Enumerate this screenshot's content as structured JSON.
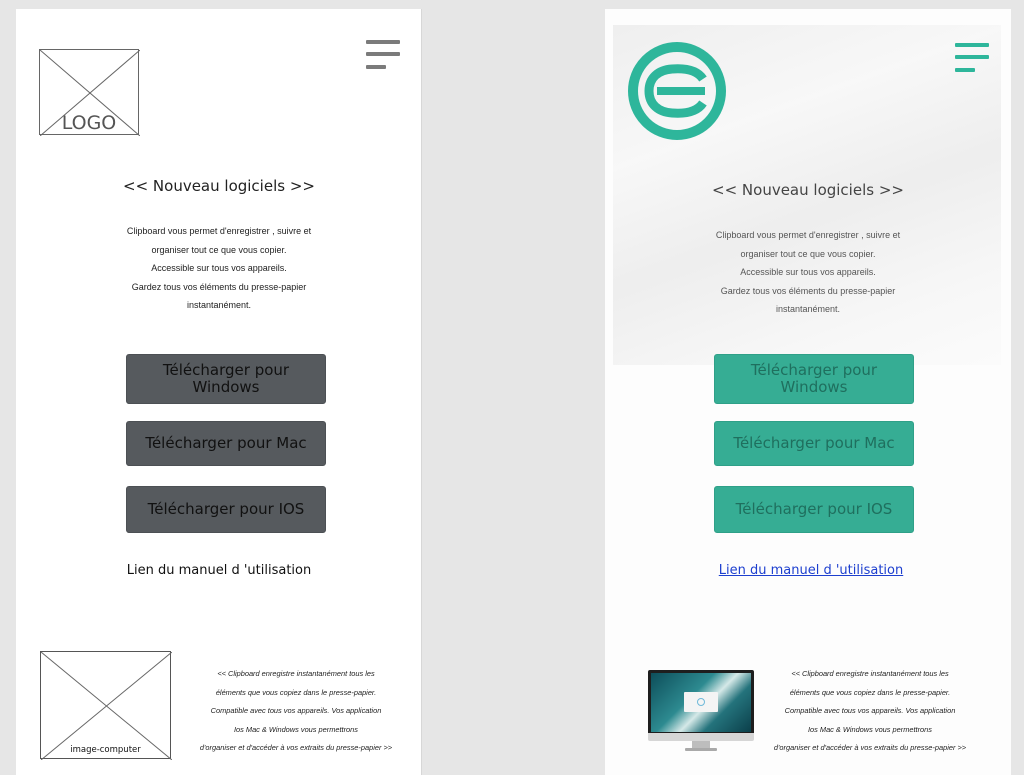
{
  "colors": {
    "accent": "#2eb69b",
    "wireframe_button": "#565a5e",
    "link": "#1d3fcf"
  },
  "icons": {
    "menu": "hamburger-icon",
    "logo_placeholder": "crossed-box",
    "brand": "teal-ring-logo"
  },
  "wireframe": {
    "logo_label": "LOGO",
    "tagline": "<< Nouveau  logiciels >>",
    "description": [
      "Clipboard  vous permet d'enregistrer , suivre et",
      "organiser tout ce que vous copier.",
      "Accessible sur tous vos appareils.",
      "Gardez tous vos éléments du presse-papier",
      "instantanément."
    ],
    "buttons": {
      "windows": "Télécharger pour Windows",
      "mac": "Télécharger pour Mac",
      "ios": "Télécharger pour IOS"
    },
    "manual_link": "Lien du manuel d 'utilisation",
    "image_label": "image-computer",
    "footer": [
      "<< Clipboard  enregistre  instantanément  tous les",
      "éléments que vous copiez dans le presse-papier.",
      "Compatible  avec tous vos appareils. Vos application",
      "Ios Mac & Windows vous permettrons",
      "d'organiser et d'accéder à vos extraits du presse-papier >>"
    ]
  },
  "mockup": {
    "tagline": "<< Nouveau  logiciels >>",
    "description": [
      "Clipboard  vous permet d'enregistrer , suivre et",
      "organiser tout ce que vous copier.",
      "Accessible sur tous vos appareils.",
      "Gardez tous vos éléments du presse-papier",
      "instantanément."
    ],
    "buttons": {
      "windows": "Télécharger pour Windows",
      "mac": "Télécharger pour Mac",
      "ios": "Télécharger pour IOS"
    },
    "manual_link": "Lien du manuel d 'utilisation ",
    "footer": [
      "<< Clipboard  enregistre  instantanément  tous les",
      "éléments que vous copiez dans le presse-papier.",
      "Compatible  avec tous vos appareils. Vos application",
      "Ios Mac & Windows vous permettrons",
      "d'organiser et d'accéder à vos extraits du presse-papier >>"
    ]
  }
}
